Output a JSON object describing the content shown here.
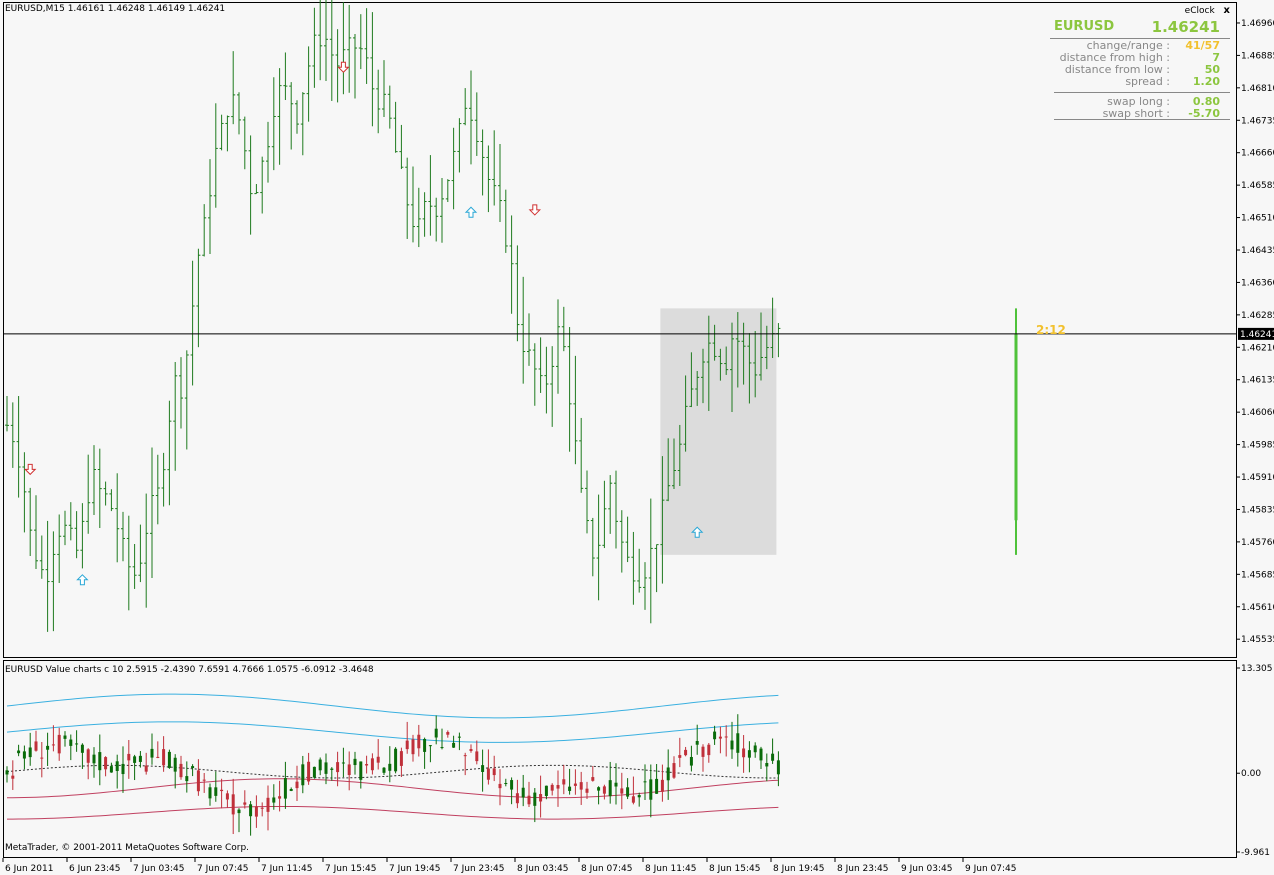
{
  "chart_header": "EURUSD,M15  1.46161 1.46248 1.46149 1.46241",
  "indicator_header": "EURUSD Value charts c 10 2.5915 -2.4390 7.6591 4.7666 1.0575 -6.0912 -3.4648",
  "copyright": "MetaTrader, © 2001-2011 MetaQuotes Software Corp.",
  "timer": "2:12",
  "eclock": {
    "title": "eClock",
    "close": "x",
    "symbol": "EURUSD",
    "price": "1.46241",
    "rows": [
      {
        "label": "change/range :",
        "value": "41/57",
        "color": "#f2c12e"
      },
      {
        "label": "distance from high :",
        "value": "7",
        "color": "#8cc63f"
      },
      {
        "label": "distance from low :",
        "value": "50",
        "color": "#8cc63f"
      },
      {
        "label": "spread :",
        "value": "1.20",
        "color": "#8cc63f"
      }
    ],
    "swap_rows": [
      {
        "label": "swap long :",
        "value": "0.80",
        "color": "#8cc63f"
      },
      {
        "label": "swap short :",
        "value": "-5.70",
        "color": "#8cc63f"
      }
    ]
  },
  "chart_data": [
    {
      "type": "bar",
      "title": "EURUSD,M15  1.46161 1.46248 1.46149 1.46241",
      "ylim": [
        1.4551,
        1.4699
      ],
      "y_ticks": [
        "1.46960",
        "1.46885",
        "1.46810",
        "1.46735",
        "1.46660",
        "1.46585",
        "1.46510",
        "1.46435",
        "1.46360",
        "1.46285",
        "1.46210",
        "1.46135",
        "1.46060",
        "1.45985",
        "1.45910",
        "1.45835",
        "1.45760",
        "1.45685",
        "1.45610",
        "1.45535"
      ],
      "x_ticks": [
        "6 Jun 2011",
        "6 Jun 23:45",
        "7 Jun 03:45",
        "7 Jun 07:45",
        "7 Jun 11:45",
        "7 Jun 15:45",
        "7 Jun 19:45",
        "7 Jun 23:45",
        "8 Jun 03:45",
        "8 Jun 07:45",
        "8 Jun 11:45",
        "8 Jun 15:45",
        "8 Jun 19:45",
        "8 Jun 23:45",
        "9 Jun 03:45",
        "9 Jun 07:45"
      ],
      "current_price": 1.46241,
      "current_price_label": "1.46241",
      "close_path": [
        1.4603,
        1.46,
        1.4592,
        1.4578,
        1.4572,
        1.4567,
        1.4575,
        1.458,
        1.4578,
        1.4573,
        1.458,
        1.4592,
        1.4588,
        1.4586,
        1.4583,
        1.4575,
        1.457,
        1.4568,
        1.4578,
        1.4584,
        1.4588,
        1.4603,
        1.4613,
        1.4612,
        1.4626,
        1.4642,
        1.465,
        1.4664,
        1.467,
        1.4678,
        1.4677,
        1.4668,
        1.4657,
        1.466,
        1.4668,
        1.4678,
        1.4681,
        1.4679,
        1.4675,
        1.4683,
        1.469,
        1.4693,
        1.4692,
        1.4686,
        1.4688,
        1.469,
        1.4691,
        1.4687,
        1.468,
        1.4678,
        1.4674,
        1.4665,
        1.4657,
        1.4651,
        1.4648,
        1.4655,
        1.4653,
        1.4657,
        1.4662,
        1.4668,
        1.4678,
        1.4675,
        1.4668,
        1.466,
        1.4655,
        1.465,
        1.464,
        1.4625,
        1.462,
        1.4616,
        1.4611,
        1.4615,
        1.4625,
        1.462,
        1.4605,
        1.4588,
        1.4578,
        1.4572,
        1.4581,
        1.459,
        1.4579,
        1.4572,
        1.457,
        1.4568,
        1.4572,
        1.4577,
        1.4584,
        1.4592,
        1.4597,
        1.4606,
        1.4613,
        1.462,
        1.4622,
        1.4621,
        1.4617,
        1.4624,
        1.4622,
        1.4618,
        1.4616,
        1.462,
        1.4622,
        1.4624
      ],
      "signals": [
        {
          "type": "down",
          "bar": 4,
          "price": 1.4593
        },
        {
          "type": "up",
          "bar": 13,
          "price": 1.4567
        },
        {
          "type": "down",
          "bar": 58,
          "price": 1.4686
        },
        {
          "type": "up",
          "bar": 80,
          "price": 1.4652
        },
        {
          "type": "down",
          "bar": 91,
          "price": 1.4653
        },
        {
          "type": "up",
          "bar": 119,
          "price": 1.4578
        }
      ],
      "range_box": {
        "bar_start": 113,
        "bar_end": 133,
        "price_top": 1.463,
        "price_bottom": 1.4573
      },
      "live_bar": {
        "high": 1.463,
        "low": 1.4573,
        "open": 1.4581,
        "close": 1.46241
      }
    },
    {
      "type": "bar",
      "title": "EURUSD Value charts c 10 2.5915 -2.4390 7.6591 4.7666 1.0575 -6.0912 -3.4648",
      "ylim": [
        -9.961,
        13.305
      ],
      "y_ticks": [
        "13.305",
        "0.00",
        "-9.961"
      ],
      "x_ticks": [
        "6 Jun 2011",
        "6 Jun 23:45",
        "7 Jun 03:45",
        "7 Jun 07:45",
        "7 Jun 11:45",
        "7 Jun 15:45",
        "7 Jun 19:45",
        "7 Jun 23:45",
        "8 Jun 03:45",
        "8 Jun 07:45",
        "8 Jun 11:45",
        "8 Jun 15:45",
        "8 Jun 19:45",
        "8 Jun 23:45",
        "9 Jun 03:45",
        "9 Jun 07:45"
      ],
      "colors": {
        "up": "#0a6b0a",
        "down": "#c0303a",
        "band_upper": "#3ab0e0",
        "band_lower": "#c04060",
        "midline": "#333333"
      }
    }
  ],
  "colors": {
    "background": "#f7f7f7",
    "bar": "#1e7a1e",
    "bid_line": "#000000",
    "range_box": "#dcdcdc",
    "live_bar": "#4fc23a",
    "signal_up": "#2aa7d6",
    "signal_down": "#d03030",
    "timer": "#f2c12e"
  }
}
